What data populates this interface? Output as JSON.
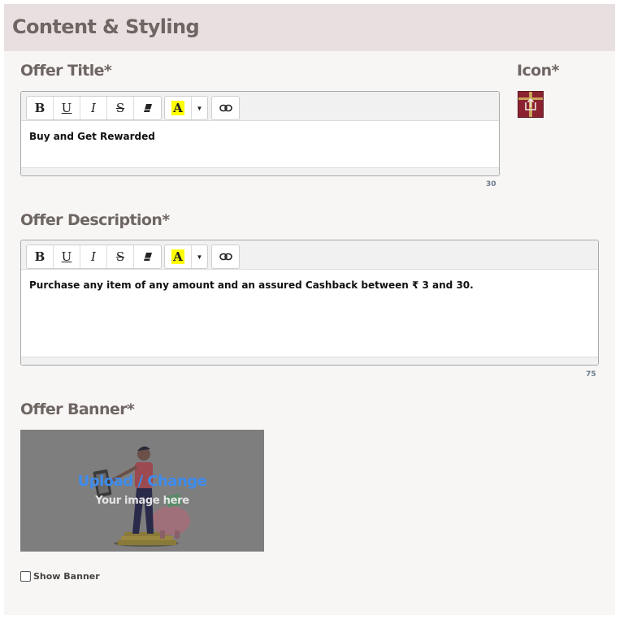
{
  "panel": {
    "title": "Content & Styling"
  },
  "offer_title": {
    "label": "Offer Title*",
    "value": "Buy and Get Rewarded",
    "char_count": "30"
  },
  "icon": {
    "label": "Icon*",
    "icon_name": "upload-gift-icon",
    "color": "#8b2230"
  },
  "toolbar": {
    "bold": "B",
    "underline": "U",
    "italic": "I",
    "strike": "S",
    "clear_format_icon": "eraser-icon",
    "highlight": "A",
    "highlight_color": "#ffff00",
    "dropdown_icon": "caret-down-icon",
    "link_icon": "link-icon"
  },
  "offer_description": {
    "label": "Offer Description*",
    "value": "Purchase any item of any amount and an assured Cashback between ₹ 3 and 30.",
    "char_count": "75"
  },
  "offer_banner": {
    "label": "Offer Banner*",
    "upload_text": "Upload / Change",
    "sub_text": "Your image here",
    "upload_color": "#3d8cf0"
  },
  "show_banner": {
    "label": "Show Banner",
    "checked": false
  }
}
